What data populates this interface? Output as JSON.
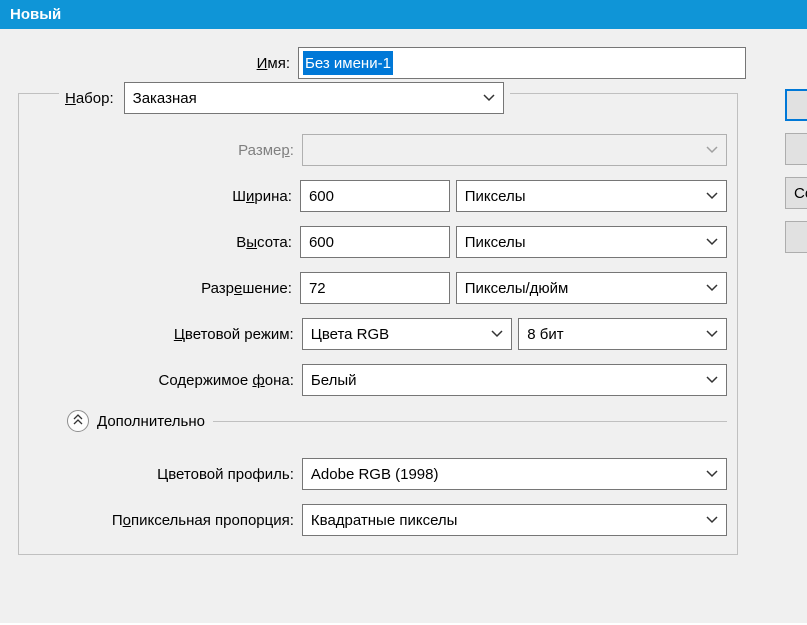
{
  "title": "Новый",
  "name": {
    "label": "Имя:",
    "underline": "И",
    "value": "Без имени-1"
  },
  "preset": {
    "label": "Набор:",
    "underline": "Н",
    "value": "Заказная"
  },
  "size": {
    "label": "Размер:",
    "underline": "Р",
    "value": ""
  },
  "width": {
    "label": "Ширина:",
    "underline": "и",
    "prefix": "Ш",
    "suffix": "рина:",
    "value": "600",
    "unit": "Пикселы"
  },
  "height": {
    "label": "Высота:",
    "prefix": "В",
    "underline": "ы",
    "suffix": "сота:",
    "value": "600",
    "unit": "Пикселы"
  },
  "resolution": {
    "label": "Разрешение:",
    "prefix": "Разр",
    "underline": "е",
    "suffix": "шение:",
    "value": "72",
    "unit": "Пикселы/дюйм"
  },
  "color_mode": {
    "label": "Цветовой режим:",
    "underline": "Ц",
    "suffix": "ветовой режим:",
    "value": "Цвета RGB",
    "depth": "8 бит"
  },
  "background": {
    "label": "Содержимое фона:",
    "prefix": "Содержимое ",
    "underline": "ф",
    "suffix": "она:",
    "value": "Белый"
  },
  "advanced_label": "Дополнительно",
  "color_profile": {
    "label": "Цветовой профиль:",
    "value": "Adobe RGB (1998)"
  },
  "pixel_aspect": {
    "label": "Попиксельная пропорция:",
    "prefix": "П",
    "underline": "о",
    "suffix": "пиксельная пропорция:",
    "value": "Квадратные пикселы"
  },
  "side": {
    "ok": "",
    "cancel": "",
    "save_preset": "Со",
    "delete_preset": ""
  }
}
